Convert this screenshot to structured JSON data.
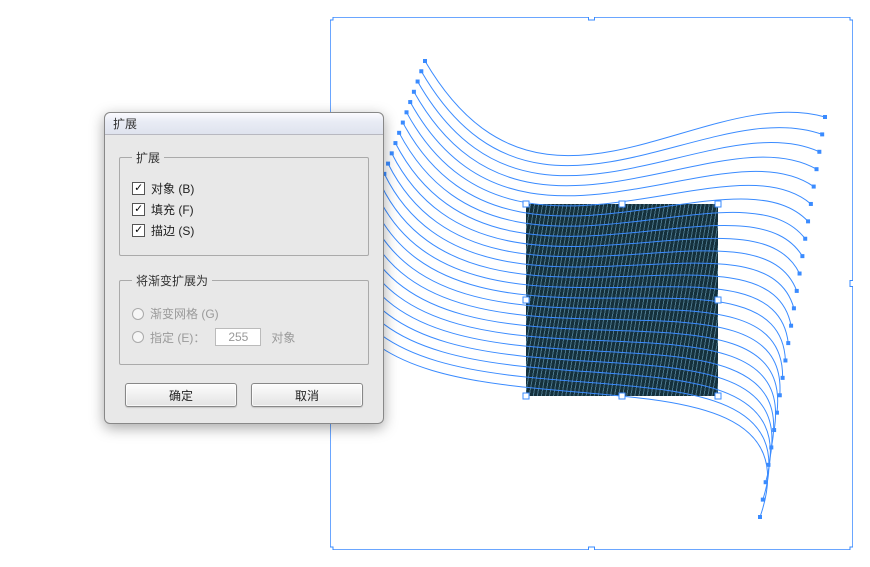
{
  "dialog": {
    "title": "扩展",
    "group_expand": {
      "legend": "扩展",
      "object_label": "对象 (B)",
      "fill_label": "填充 (F)",
      "stroke_label": "描边 (S)",
      "object_checked": true,
      "fill_checked": true,
      "stroke_checked": true
    },
    "group_gradient": {
      "legend": "将渐变扩展为",
      "mesh_label": "渐变网格 (G)",
      "specify_label": "指定 (E)：",
      "specify_value": "255",
      "specify_suffix": "对象"
    },
    "buttons": {
      "ok": "确定",
      "cancel": "取消"
    }
  },
  "canvas": {
    "dark_rect_color": "#14303c",
    "selection_color": "#3a8bff",
    "blend_steps": 24
  }
}
